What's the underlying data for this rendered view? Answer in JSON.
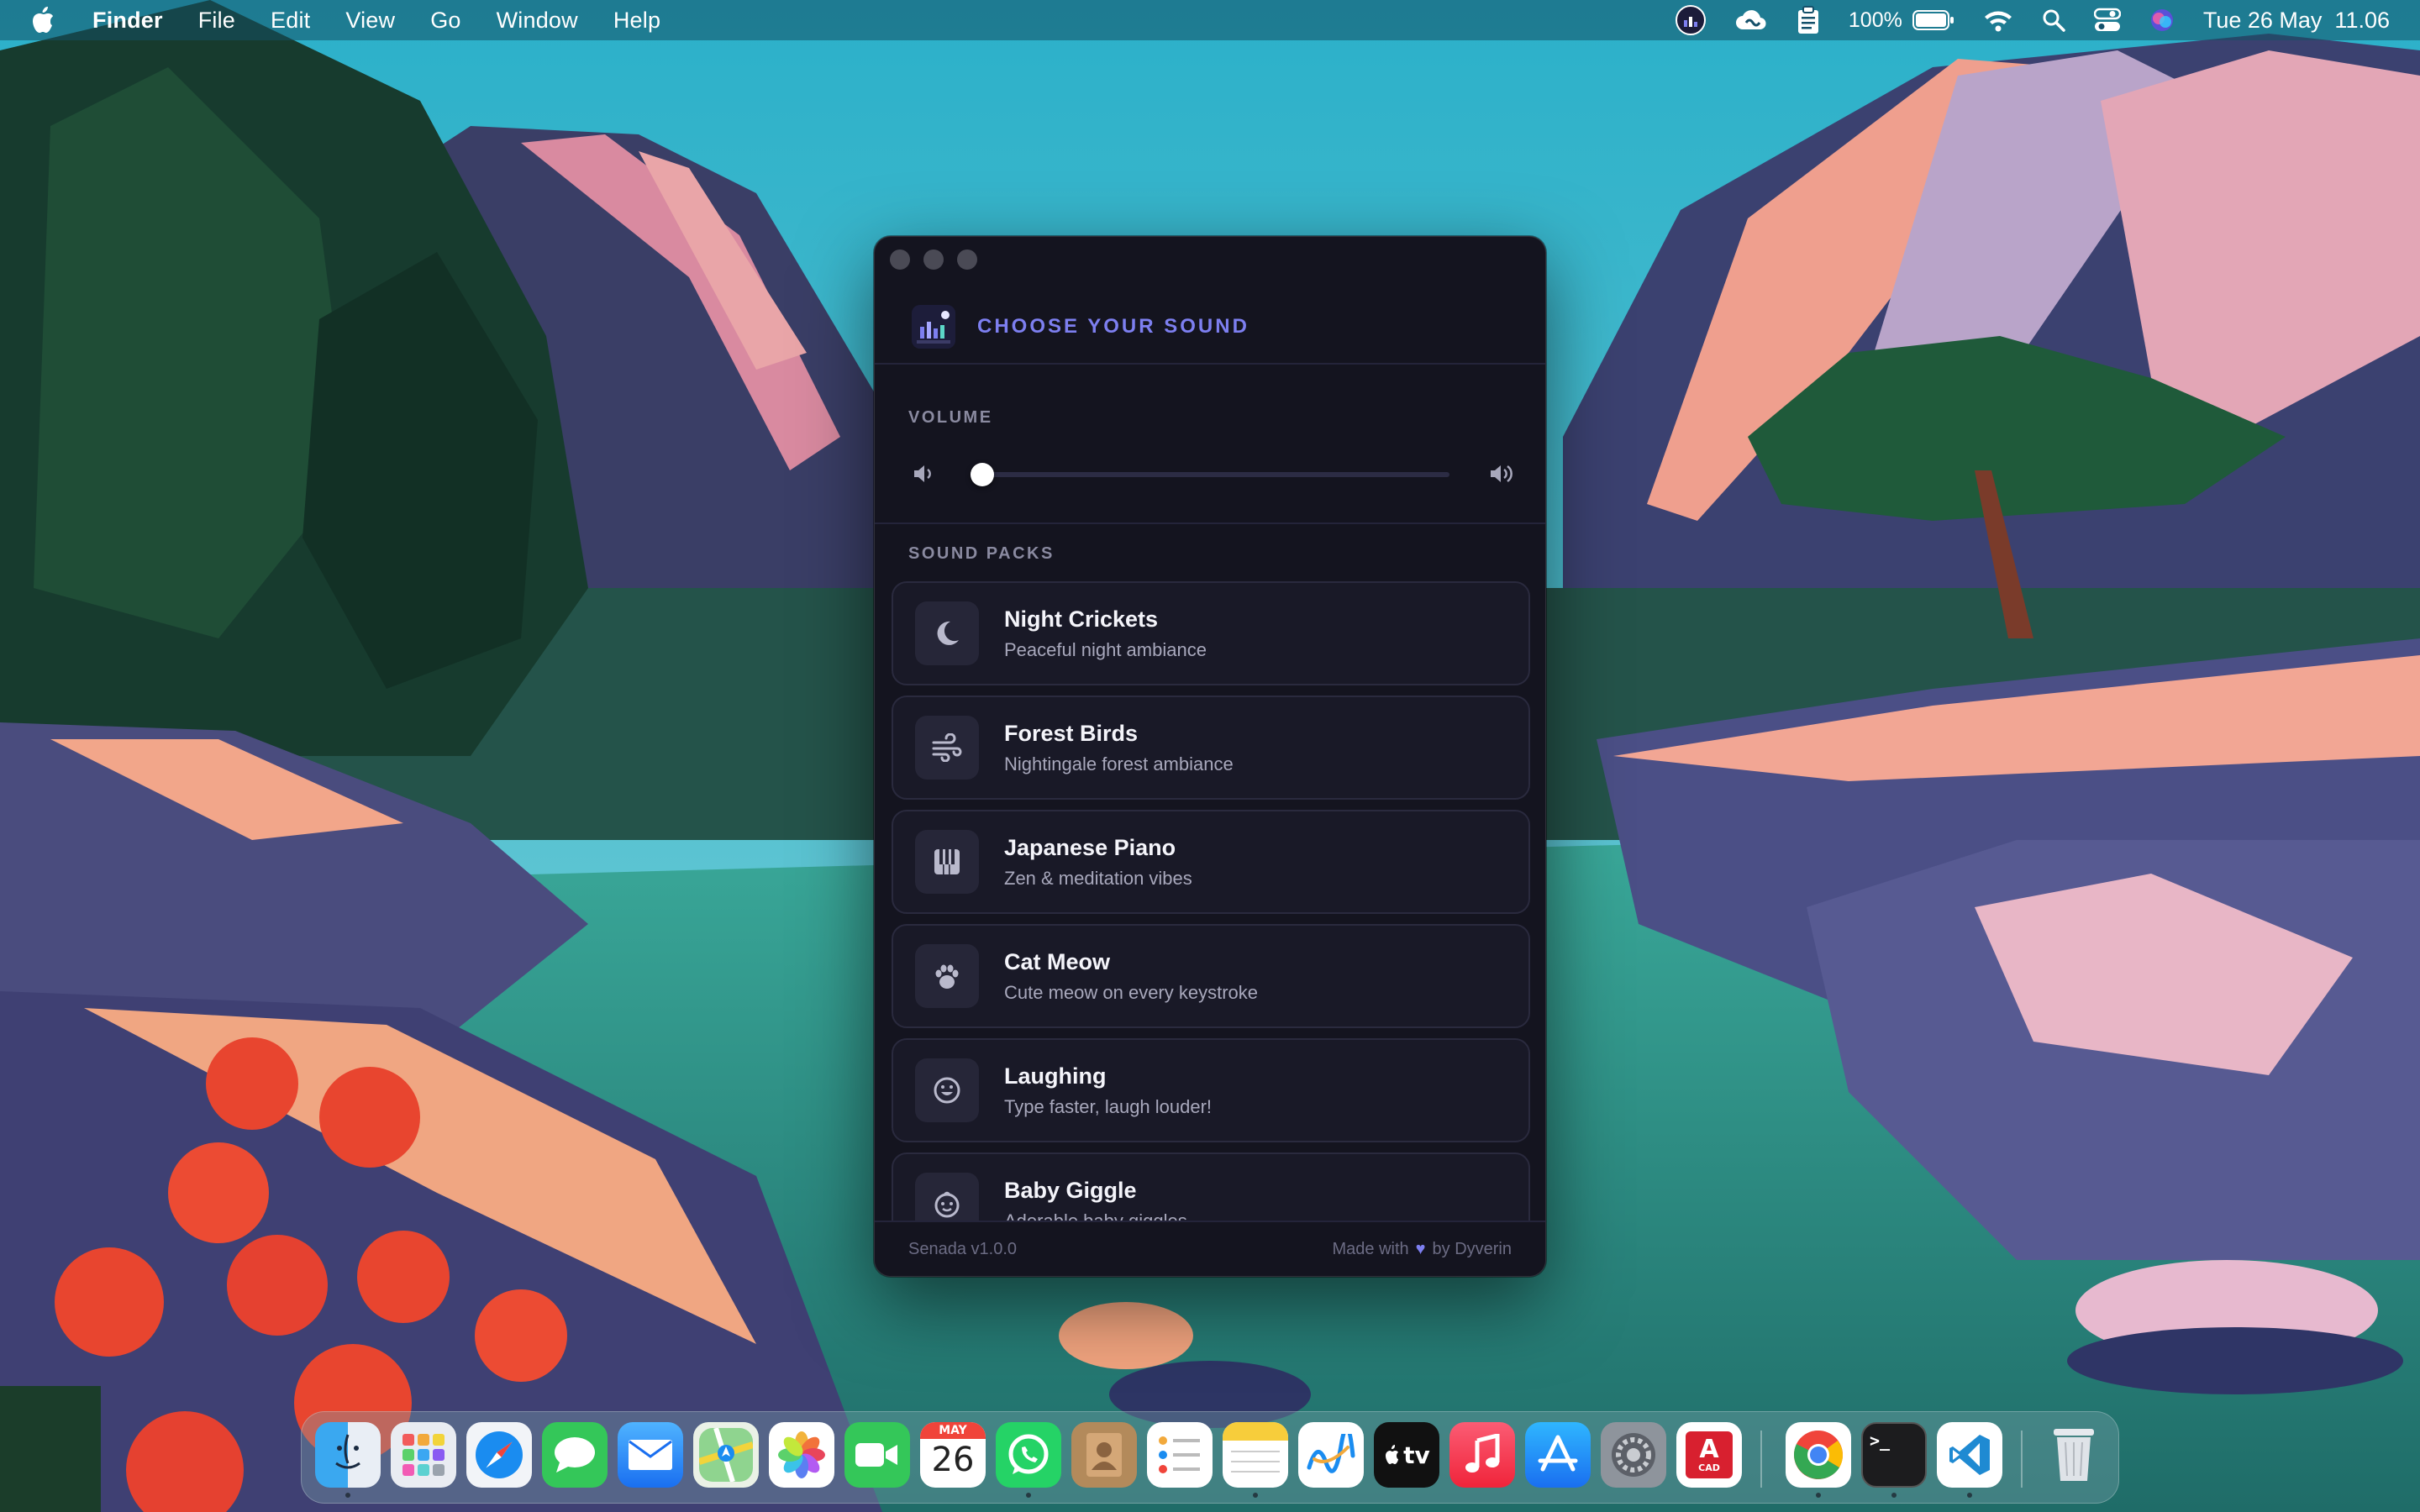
{
  "menubar": {
    "app_name": "Finder",
    "items": [
      "File",
      "Edit",
      "View",
      "Go",
      "Window",
      "Help"
    ],
    "battery_percent": "100%",
    "clock": "Tue 26 May  11.06"
  },
  "app": {
    "title": "CHOOSE YOUR SOUND",
    "volume": {
      "label": "VOLUME",
      "level": 0.0
    },
    "packs_label": "SOUND PACKS",
    "packs": [
      {
        "title": "Night Crickets",
        "desc": "Peaceful night ambiance",
        "icon": "moon-icon"
      },
      {
        "title": "Forest Birds",
        "desc": "Nightingale forest ambiance",
        "icon": "wind-icon"
      },
      {
        "title": "Japanese Piano",
        "desc": "Zen & meditation vibes",
        "icon": "piano-icon"
      },
      {
        "title": "Cat Meow",
        "desc": "Cute meow on every keystroke",
        "icon": "paw-icon"
      },
      {
        "title": "Laughing",
        "desc": "Type faster, laugh louder!",
        "icon": "smile-icon"
      },
      {
        "title": "Baby Giggle",
        "desc": "Adorable baby giggles",
        "icon": "baby-icon"
      }
    ],
    "footer": {
      "version": "Senada v1.0.0",
      "made_with": "Made with",
      "by": "by Dyverin"
    }
  },
  "dock": {
    "apps": [
      {
        "name": "Finder",
        "icon": "finder-icon",
        "running": true
      },
      {
        "name": "Launchpad",
        "icon": "launchpad-icon",
        "running": false
      },
      {
        "name": "Safari",
        "icon": "safari-icon",
        "running": false
      },
      {
        "name": "Messages",
        "icon": "messages-icon",
        "running": false
      },
      {
        "name": "Mail",
        "icon": "mail-icon",
        "running": false
      },
      {
        "name": "Maps",
        "icon": "maps-icon",
        "running": false
      },
      {
        "name": "Photos",
        "icon": "photos-icon",
        "running": false
      },
      {
        "name": "FaceTime",
        "icon": "facetime-icon",
        "running": false
      },
      {
        "name": "Calendar",
        "icon": "calendar-icon",
        "running": false,
        "month": "MAY",
        "day": "26"
      },
      {
        "name": "WhatsApp",
        "icon": "whatsapp-icon",
        "running": true
      },
      {
        "name": "Contacts",
        "icon": "contacts-icon",
        "running": false
      },
      {
        "name": "Reminders",
        "icon": "reminders-icon",
        "running": false
      },
      {
        "name": "Notes",
        "icon": "notes-icon",
        "running": true
      },
      {
        "name": "Freeform",
        "icon": "freeform-icon",
        "running": false
      },
      {
        "name": "TV",
        "icon": "tv-icon",
        "running": false,
        "label": "tv"
      },
      {
        "name": "Music",
        "icon": "music-icon",
        "running": false
      },
      {
        "name": "App Store",
        "icon": "appstore-icon",
        "running": false
      },
      {
        "name": "System Settings",
        "icon": "settings-icon",
        "running": false
      },
      {
        "name": "AutoCAD",
        "icon": "autocad-icon",
        "running": false,
        "label": "A",
        "sublabel": "CAD"
      },
      {
        "name": "Chrome",
        "icon": "chrome-icon",
        "running": true
      },
      {
        "name": "Terminal",
        "icon": "terminal-icon",
        "running": true,
        "label": ">_"
      },
      {
        "name": "VS Code",
        "icon": "vscode-icon",
        "running": true
      },
      {
        "name": "Trash",
        "icon": "trash-icon",
        "running": false
      }
    ]
  }
}
